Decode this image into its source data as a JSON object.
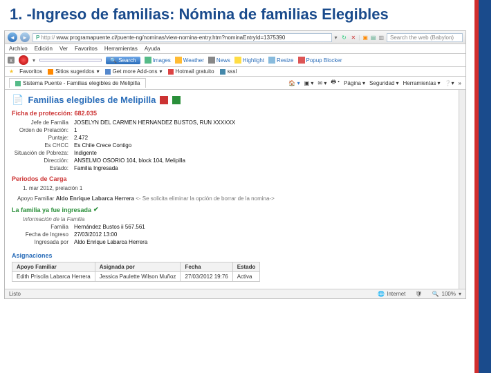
{
  "slide": {
    "title": "1. -Ingreso de familias: Nómina de familias Elegibles"
  },
  "browser": {
    "url_prefix": "http://",
    "url": "www.programapuente.cl/puente-ng/nominas/view-nomina-entry.htm?nominaEntryId=1375390",
    "search_placeholder": "Search the web (Babylon)",
    "menu": [
      "Archivo",
      "Edición",
      "Ver",
      "Favoritos",
      "Herramientas",
      "Ayuda"
    ],
    "ask": {
      "search_label": "Search",
      "tools": [
        "Images",
        "Weather",
        "News",
        "Highlight",
        "Resize",
        "Popup Blocker"
      ]
    },
    "favbar": {
      "label": "Favoritos",
      "items": [
        "Sitios sugeridos",
        "Get more Add-ons",
        "Hotmail gratuito",
        "sssl"
      ]
    },
    "tab": "Sistema Puente - Familias elegibles de Melipilla",
    "cmdbar": [
      "Página",
      "Seguridad",
      "Herramientas"
    ],
    "status": {
      "done": "Listo",
      "zone": "Internet",
      "zoom": "100%"
    }
  },
  "page": {
    "title": "Familias elegibles de Melipilla",
    "ficha_label": "Ficha de protección:",
    "ficha_value": "682.035",
    "fields": [
      {
        "label": "Jefe de Familia",
        "value": "JOSELYN DEL CARMEN HERNANDEZ BUSTOS, RUN   XXXXXX"
      },
      {
        "label": "Orden de Prelación:",
        "value": "1"
      },
      {
        "label": "Puntaje:",
        "value": "2.472"
      },
      {
        "label": "Es CHCC",
        "value": "Es Chile Crece Contigo"
      },
      {
        "label": "Situación de Pobreza:",
        "value": "Indigente"
      },
      {
        "label": "Dirección:",
        "value": "ANSELMO OSORIO 104, block 104, Melipilla"
      },
      {
        "label": "Estado:",
        "value": "Familia Ingresada"
      }
    ],
    "periodos_label": "Periodos de Carga",
    "periodo_line": "1.  mar 2012, prelación 1",
    "apoyo_label": "Apoyo Familiar",
    "apoyo_name": "Aldo Enrique Labarca Herrera",
    "apoyo_note": "<- Se solicita eliminar la opción de borrar de la nomina->",
    "ingresada_msg": "La familia ya fue ingresada",
    "info_label": "Información de la Familia",
    "info_fields": [
      {
        "label": "Familia",
        "value": "Hernández Bustos ii 567.561"
      },
      {
        "label": "Fecha de Ingreso",
        "value": "27/03/2012 13:00"
      },
      {
        "label": "Ingresada por",
        "value": "Aldo Enrique Labarca Herrera"
      }
    ],
    "asign_label": "Asignaciones",
    "asign_headers": [
      "Apoyo Familiar",
      "Asignada por",
      "Fecha",
      "Estado"
    ],
    "asign_row": [
      "Edith Priscila Labarca Herrera",
      "Jessica Paulette Wilson Muñoz",
      "27/03/2012 19:76",
      "Activa"
    ]
  }
}
